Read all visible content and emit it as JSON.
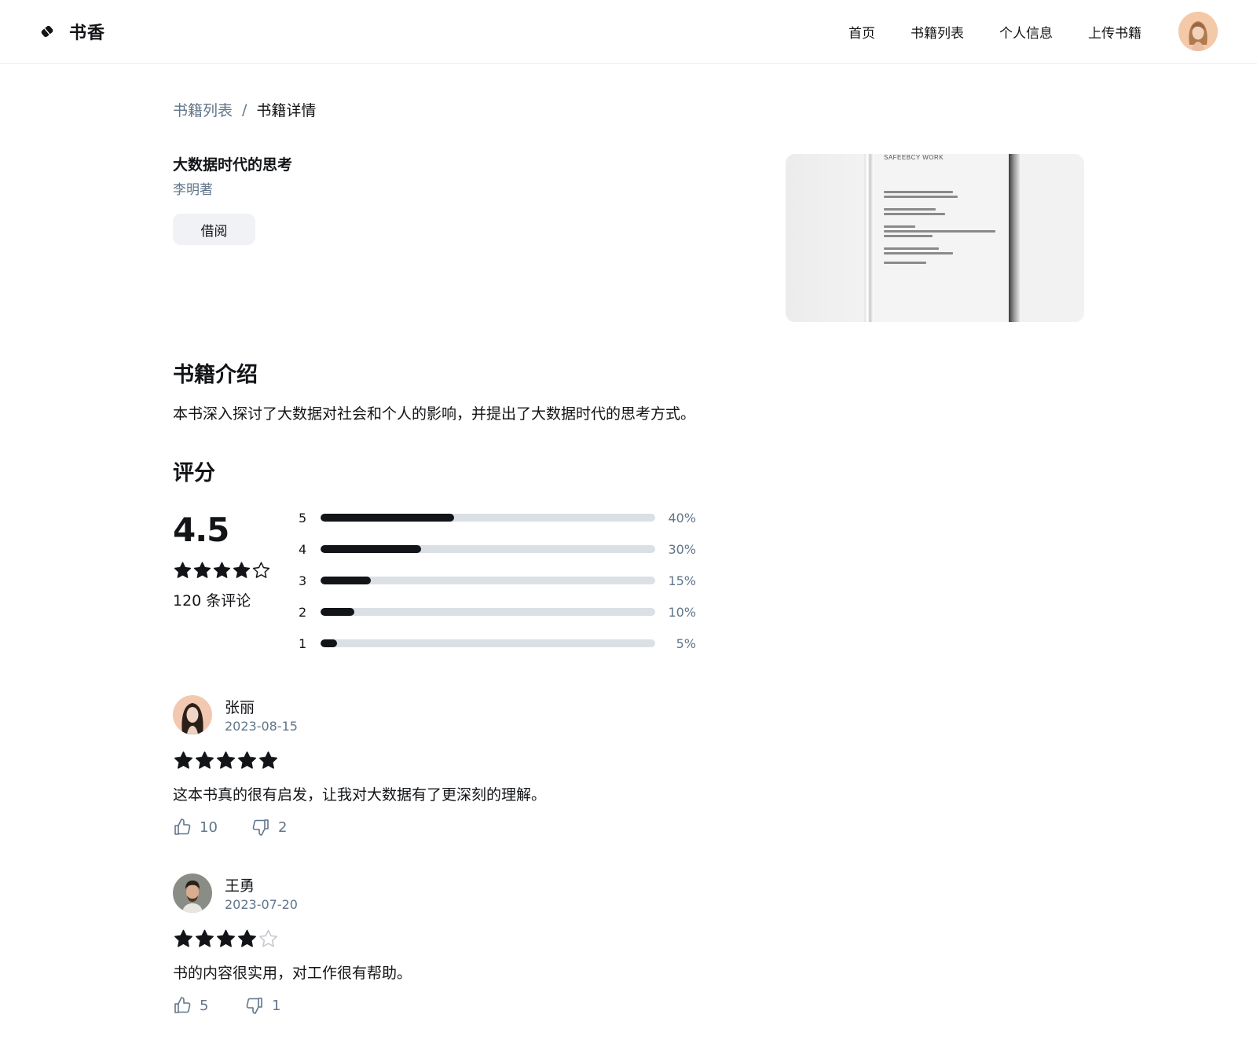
{
  "header": {
    "brand": "书香",
    "nav": [
      "首页",
      "书籍列表",
      "个人信息",
      "上传书籍"
    ]
  },
  "breadcrumb": {
    "parent": "书籍列表",
    "separator": "/",
    "current": "书籍详情"
  },
  "book": {
    "title": "大数据时代的思考",
    "author": "李明著",
    "borrow_label": "借阅",
    "cover_heading": "SAFEEBCY WORK"
  },
  "intro": {
    "heading": "书籍介绍",
    "text": "本书深入探讨了大数据对社会和个人的影响，并提出了大数据时代的思考方式。"
  },
  "rating": {
    "heading": "评分",
    "average": "4.5",
    "average_value": 4.5,
    "count_text": "120 条评论",
    "distribution": [
      {
        "stars": "5",
        "percent": 40,
        "label": "40%"
      },
      {
        "stars": "4",
        "percent": 30,
        "label": "30%"
      },
      {
        "stars": "3",
        "percent": 15,
        "label": "15%"
      },
      {
        "stars": "2",
        "percent": 10,
        "label": "10%"
      },
      {
        "stars": "1",
        "percent": 5,
        "label": "5%"
      }
    ]
  },
  "reviews": [
    {
      "name": "张丽",
      "date": "2023-08-15",
      "stars": 5,
      "text": "这本书真的很有启发，让我对大数据有了更深刻的理解。",
      "likes": "10",
      "dislikes": "2"
    },
    {
      "name": "王勇",
      "date": "2023-07-20",
      "stars": 4,
      "text": "书的内容很实用，对工作很有帮助。",
      "likes": "5",
      "dislikes": "1"
    }
  ],
  "colors": {
    "text": "#121417",
    "muted": "#61758a",
    "track": "#dbe0e5",
    "button_bg": "#f0f2f5"
  }
}
